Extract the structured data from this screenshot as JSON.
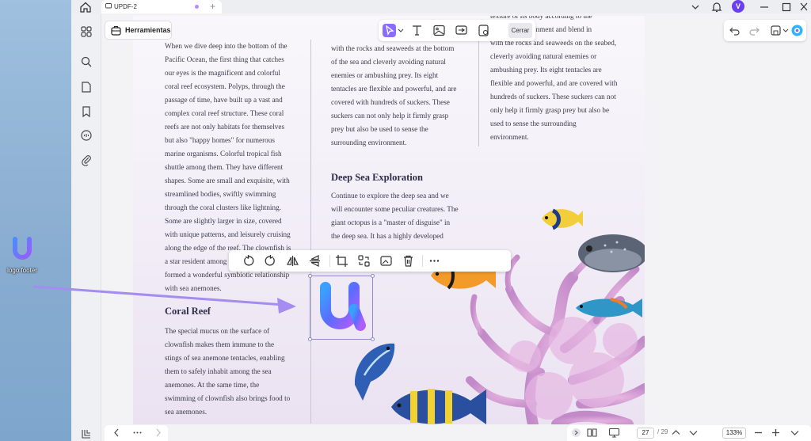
{
  "desktop": {
    "icon_label": "logo footer"
  },
  "titlebar": {
    "tab_title": "UPDF-2",
    "avatar_initial": "V"
  },
  "toolbar": {
    "tools_button": "Herramientas",
    "close_button": "Cerrar"
  },
  "document": {
    "col1": [
      "When we dive deep into the bottom of the",
      "Pacific Ocean, the first thing that catches",
      "our eyes is the magnificent and colorful",
      "coral reef ecosystem. Polyps, through the",
      "passage of time, have built up a vast and",
      "complex coral reef structure. These coral",
      "reefs are not only habitats for themselves",
      "but also \"happy homes\" for numerous",
      "marine organisms. Colorful tropical fish",
      "shuttle among them. They have different",
      "shapes. Some are small and exquisite, with",
      "streamlined bodies, swiftly swimming",
      "through the coral clusters like lightning.",
      "Some are slightly larger in size, covered",
      "with unique patterns, and leisurely cruising",
      "along the edge of the reef. The clownfish is",
      "a star resident among the coral reefs, and it",
      "formed a wonderful symbiotic relationship",
      "with sea anemones."
    ],
    "coral_heading": "Coral Reef",
    "col1b": [
      " The special mucus on the surface of",
      "clownfish makes them immune to the",
      "stings of sea anemone tentacles, enabling",
      "them to safely inhabit among the sea",
      "anemones. At the same time, the",
      "swimming of clownfish also brings food to",
      "sea anemones."
    ],
    "col2": [
      "with the rocks and seaweeds at the bottom",
      "of the sea and cleverly avoiding natural",
      "enemies or ambushing prey. Its eight",
      "tentacles are flexible and powerful, and are",
      "covered with hundreds of suckers. These",
      "suckers can not only help it firmly grasp",
      "prey but also be used to sense the",
      "surrounding environment."
    ],
    "deep_heading": "Deep Sea Exploration",
    "col2b": [
      "Continue to explore the deep sea and we",
      "will encounter some peculiar creatures. The",
      "giant octopus is a \"master of disguise\" in",
      "the deep sea. It has a highly developed"
    ],
    "col3": [
      "texture of its body according to the",
      "environment and blend in",
      "with the rocks and seaweeds on the seabed,",
      "cleverly avoiding natural enemies or",
      "ambushing prey. Its eight tentacles are",
      "flexible and powerful, and are covered with",
      "hundreds of suckers. These suckers can not",
      "only help it firmly grasp prey but also be",
      "used to sense the surrounding",
      "environment."
    ]
  },
  "statusbar": {
    "page_current": "27",
    "page_total": "/ 29",
    "zoom": "133%"
  }
}
